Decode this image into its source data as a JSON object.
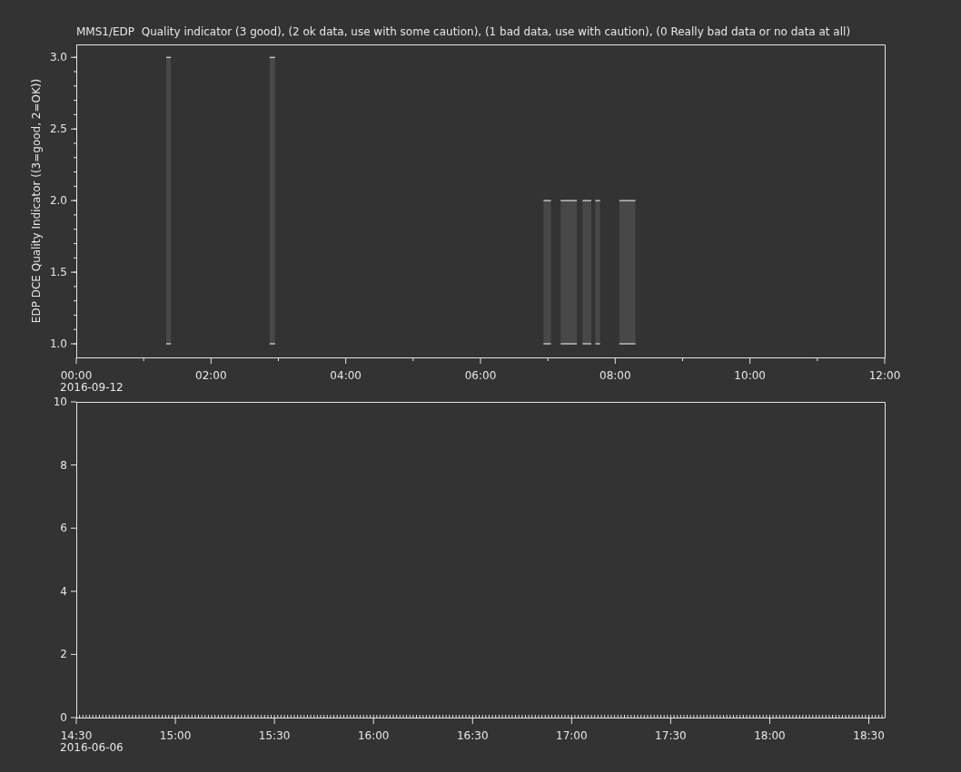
{
  "panels": [
    {
      "title": "MMS1/EDP  Quality indicator (3 good), (2 ok data, use with some caution), (1 bad data, use with caution), (0 Really bad data or no data at all)",
      "date_label": "2016-09-12",
      "chart_data": {
        "type": "candlestick",
        "ylabel": "EDP DCE Quality Indicator ((3=good, 2=OK))",
        "xlim": [
          0,
          12
        ],
        "ylim": [
          0.905,
          3.09
        ],
        "x": [
          1.37,
          2.91,
          6.99,
          7.31,
          7.58,
          7.74,
          8.18
        ],
        "ohlc": [
          [
            1,
            3,
            1,
            3
          ],
          [
            1,
            3,
            1,
            3
          ],
          [
            1,
            2,
            1,
            2
          ],
          [
            1,
            2,
            1,
            2
          ],
          [
            1,
            2,
            1,
            2
          ],
          [
            1,
            2,
            1,
            2
          ],
          [
            1,
            2,
            1,
            2
          ]
        ],
        "xticks": [
          {
            "value": 0,
            "label": "00:00"
          },
          {
            "value": 2,
            "label": "02:00"
          },
          {
            "value": 4,
            "label": "04:00"
          },
          {
            "value": 6,
            "label": "06:00"
          },
          {
            "value": 8,
            "label": "08:00"
          },
          {
            "value": 10,
            "label": "10:00"
          },
          {
            "value": 12,
            "label": "12:00"
          }
        ],
        "yticks": [
          {
            "value": 1,
            "label": "1.0"
          },
          {
            "value": 1.5,
            "label": "1.5"
          },
          {
            "value": 2,
            "label": "2.0"
          },
          {
            "value": 2.5,
            "label": "2.5"
          },
          {
            "value": 3,
            "label": "3.0"
          }
        ]
      }
    },
    {
      "date_label": "2016-06-06",
      "chart_data": {
        "type": "line",
        "xlim": [
          14.5,
          18.58
        ],
        "ylim": [
          0,
          10
        ],
        "xticks": [
          {
            "value": 14.5,
            "label": "14:30"
          },
          {
            "value": 15,
            "label": "15:00"
          },
          {
            "value": 15.5,
            "label": "15:30"
          },
          {
            "value": 16,
            "label": "16:00"
          },
          {
            "value": 16.5,
            "label": "16:30"
          },
          {
            "value": 17,
            "label": "17:00"
          },
          {
            "value": 17.5,
            "label": "17:30"
          },
          {
            "value": 18,
            "label": "18:00"
          },
          {
            "value": 18.5,
            "label": "18:30"
          }
        ],
        "yticks": [
          0,
          2,
          4,
          6,
          8,
          10
        ]
      }
    }
  ]
}
